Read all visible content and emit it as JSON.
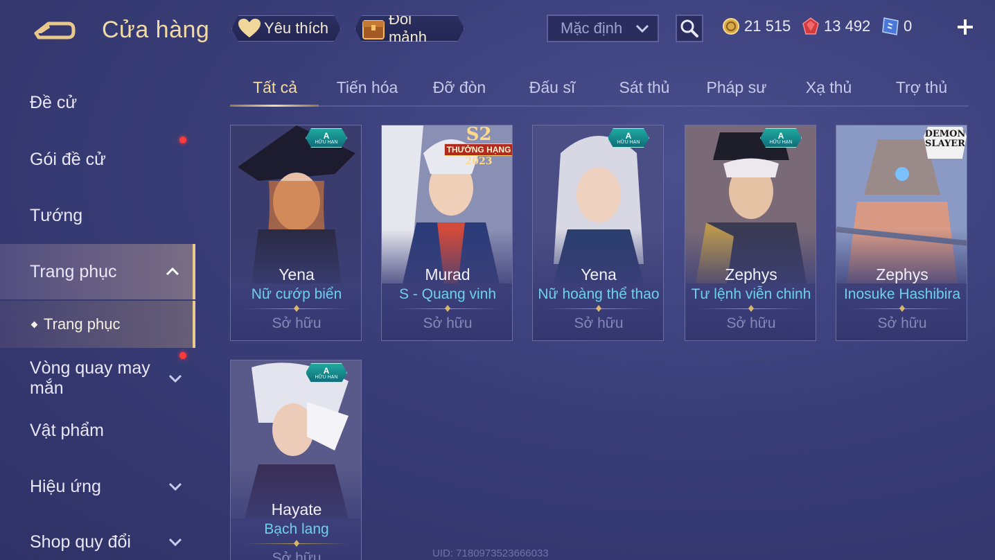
{
  "header": {
    "title": "Cửa hàng",
    "favorite_label": "Yêu thích",
    "shard_label": "Đổi mảnh",
    "sort_value": "Mặc định",
    "currencies": [
      {
        "icon": "gold-coin-icon",
        "value": "21 515"
      },
      {
        "icon": "ruby-gem-icon",
        "value": "13 492"
      },
      {
        "icon": "blue-ticket-icon",
        "value": "0"
      }
    ]
  },
  "sidebar": {
    "items": [
      {
        "label": "Đề cử"
      },
      {
        "label": "Gói đề cử"
      },
      {
        "label": "Tướng"
      },
      {
        "label": "Trang phục"
      },
      {
        "label": "Vòng quay may mắn"
      },
      {
        "label": "Vật phẩm"
      },
      {
        "label": "Hiệu ứng"
      },
      {
        "label": "Shop quy đổi"
      }
    ],
    "sub_item": "Trang phục"
  },
  "tabs": [
    "Tất cả",
    "Tiến hóa",
    "Đỡ đòn",
    "Đấu sĩ",
    "Sát thủ",
    "Pháp sư",
    "Xạ thủ",
    "Trợ thủ"
  ],
  "cards": [
    {
      "hero": "Yena",
      "skin": "Nữ cướp biển",
      "status": "Sở hữu",
      "badge_grade": "A",
      "badge_label": "HỮU HẠN"
    },
    {
      "hero": "Murad",
      "skin": "S - Quang vinh",
      "status": "Sở hữu",
      "rank_badge": {
        "season": "S2",
        "label": "THƯỞNG HẠNG",
        "year": "2023"
      }
    },
    {
      "hero": "Yena",
      "skin": "Nữ hoàng thể thao",
      "status": "Sở hữu",
      "badge_grade": "A",
      "badge_label": "HỮU HẠN"
    },
    {
      "hero": "Zephys",
      "skin": "Tư lệnh viễn chinh",
      "status": "Sở hữu",
      "badge_grade": "A",
      "badge_label": "HỮU HẠN"
    },
    {
      "hero": "Zephys",
      "skin": "Inosuke Hashibira",
      "status": "Sở hữu",
      "collab_logo": "DEMON SLAYER"
    },
    {
      "hero": "Hayate",
      "skin": "Bạch lang",
      "status": "Sở hữu",
      "badge_grade": "A",
      "badge_label": "HỮU HẠN"
    }
  ],
  "footer": {
    "uid": "UID: 7180973523666033"
  },
  "colors": {
    "accent": "#f2dca4",
    "skin_name": "#6fd0ee",
    "notification": "#ff3a3a"
  }
}
